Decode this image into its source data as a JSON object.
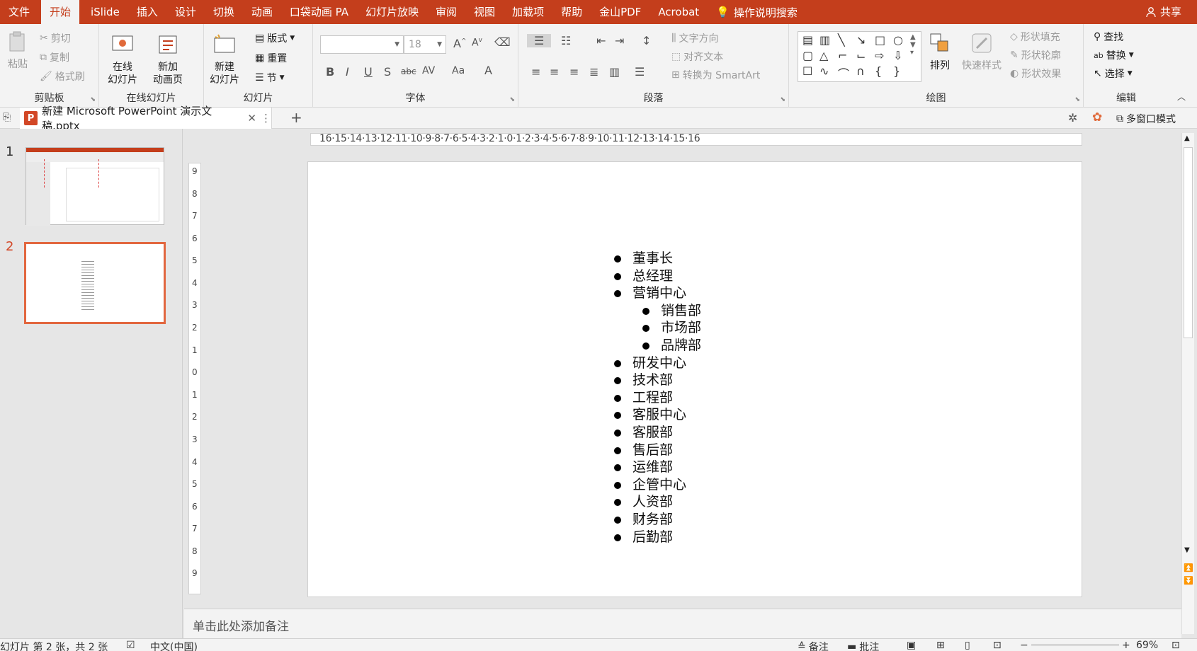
{
  "menubar": {
    "items": [
      "文件",
      "开始",
      "iSlide",
      "插入",
      "设计",
      "切换",
      "动画",
      "口袋动画 PA",
      "幻灯片放映",
      "审阅",
      "视图",
      "加载项",
      "帮助",
      "金山PDF",
      "Acrobat"
    ],
    "active_index": 1,
    "tell_me": "操作说明搜索",
    "share": "共享"
  },
  "ribbon": {
    "clipboard": {
      "paste": "粘贴",
      "cut": "剪切",
      "copy": "复制",
      "format_painter": "格式刷",
      "label": "剪贴板"
    },
    "online_slides": {
      "online": "在线\n幻灯片",
      "new_anim": "新加\n动画页",
      "label": "在线幻灯片"
    },
    "slides": {
      "new_slide": "新建\n幻灯片",
      "layout": "版式",
      "reset": "重置",
      "section": "节",
      "label": "幻灯片"
    },
    "font": {
      "font_name": "",
      "font_size": "18",
      "label": "字体"
    },
    "paragraph": {
      "text_direction": "文字方向",
      "align_text": "对齐文本",
      "smartart": "转换为 SmartArt",
      "label": "段落"
    },
    "drawing": {
      "arrange": "排列",
      "quick_styles": "快速样式",
      "fill": "形状填充",
      "outline": "形状轮廓",
      "effects": "形状效果",
      "label": "绘图"
    },
    "editing": {
      "find": "查找",
      "replace": "替换",
      "select": "选择",
      "label": "编辑"
    }
  },
  "tabbar": {
    "doc_title": "新建 Microsoft PowerPoint 演示文稿.pptx",
    "multiwindow": "多窗口模式"
  },
  "thumbnails": [
    {
      "number": "1"
    },
    {
      "number": "2"
    }
  ],
  "rulers": {
    "horizontal": "16·15·14·13·12·11·10·9·8·7·6·5·4·3·2·1·0·1·2·3·4·5·6·7·8·9·10·11·12·13·14·15·16",
    "vertical": [
      "9",
      "8",
      "7",
      "6",
      "5",
      "4",
      "3",
      "2",
      "1",
      "0",
      "1",
      "2",
      "3",
      "4",
      "5",
      "6",
      "7",
      "8",
      "9"
    ]
  },
  "slide": {
    "bullets": [
      {
        "text": "董事长",
        "level": 1
      },
      {
        "text": "总经理",
        "level": 1
      },
      {
        "text": "营销中心",
        "level": 1
      },
      {
        "text": "销售部",
        "level": 2
      },
      {
        "text": "市场部",
        "level": 2
      },
      {
        "text": "品牌部",
        "level": 2
      },
      {
        "text": "研发中心",
        "level": 1
      },
      {
        "text": "技术部",
        "level": 1
      },
      {
        "text": "工程部",
        "level": 1
      },
      {
        "text": "客服中心",
        "level": 1
      },
      {
        "text": "客服部",
        "level": 1
      },
      {
        "text": "售后部",
        "level": 1
      },
      {
        "text": "运维部",
        "level": 1
      },
      {
        "text": "企管中心",
        "level": 1
      },
      {
        "text": "人资部",
        "level": 1
      },
      {
        "text": "财务部",
        "level": 1
      },
      {
        "text": "后勤部",
        "level": 1
      }
    ]
  },
  "notes": {
    "placeholder": "单击此处添加备注"
  },
  "status": {
    "slide_info": "幻灯片 第 2 张，共 2 张",
    "language": "中文(中国)",
    "notes_btn": "备注",
    "comments_btn": "批注",
    "zoom": "69%"
  },
  "colors": {
    "accent": "#c43e1c",
    "selection": "#e2673f"
  }
}
